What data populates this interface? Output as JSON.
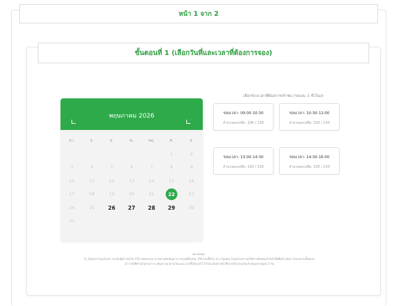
{
  "page_banner": "หน้า 1 จาก 2",
  "step_title": "ขั้นตอนที่ 1 (เลือกวันที่และเวลาที่ต้องการจอง)",
  "calendar": {
    "month_title": "พฤษภาคม 2026",
    "prev_icon": "corner-prev-icon",
    "next_icon": "corner-next-icon",
    "weekdays": [
      "อา.",
      "จ.",
      "อ.",
      "พ.",
      "พฤ.",
      "ศ.",
      "ส."
    ],
    "days": [
      {
        "label": "",
        "state": "empty"
      },
      {
        "label": "",
        "state": "empty"
      },
      {
        "label": "",
        "state": "empty"
      },
      {
        "label": "",
        "state": "empty"
      },
      {
        "label": "",
        "state": "empty"
      },
      {
        "label": "1",
        "state": "disabled"
      },
      {
        "label": "2",
        "state": "disabled"
      },
      {
        "label": "3",
        "state": "disabled"
      },
      {
        "label": "4",
        "state": "disabled"
      },
      {
        "label": "5",
        "state": "disabled"
      },
      {
        "label": "6",
        "state": "disabled"
      },
      {
        "label": "7",
        "state": "disabled"
      },
      {
        "label": "8",
        "state": "disabled"
      },
      {
        "label": "9",
        "state": "disabled"
      },
      {
        "label": "10",
        "state": "disabled"
      },
      {
        "label": "11",
        "state": "disabled"
      },
      {
        "label": "12",
        "state": "disabled"
      },
      {
        "label": "13",
        "state": "disabled"
      },
      {
        "label": "14",
        "state": "disabled"
      },
      {
        "label": "15",
        "state": "disabled"
      },
      {
        "label": "16",
        "state": "disabled"
      },
      {
        "label": "17",
        "state": "disabled"
      },
      {
        "label": "18",
        "state": "disabled"
      },
      {
        "label": "19",
        "state": "disabled"
      },
      {
        "label": "20",
        "state": "disabled"
      },
      {
        "label": "21",
        "state": "disabled"
      },
      {
        "label": "22",
        "state": "selected"
      },
      {
        "label": "23",
        "state": "disabled"
      },
      {
        "label": "24",
        "state": "disabled"
      },
      {
        "label": "25",
        "state": "disabled"
      },
      {
        "label": "26",
        "state": "available"
      },
      {
        "label": "27",
        "state": "available"
      },
      {
        "label": "28",
        "state": "available"
      },
      {
        "label": "29",
        "state": "available"
      },
      {
        "label": "30",
        "state": "disabled"
      },
      {
        "label": "31",
        "state": "disabled"
      }
    ]
  },
  "slots_heading": "เลือกช่วงเวลาที่ต้องการเข้าชม (รอบละ 1 ชั่วโมง)",
  "slots": [
    {
      "time": "รอบเวลา: 09:00-10:30",
      "remaining": "จำนวนคงเหลือ: 106 / 150"
    },
    {
      "time": "รอบเวลา: 10:30-12:00",
      "remaining": "จำนวนคงเหลือ: 150 / 150"
    },
    {
      "time": "รอบเวลา: 13:00-14:30",
      "remaining": "จำนวนคงเหลือ: 150 / 150"
    },
    {
      "time": "รอบเวลา: 14:30-16:00",
      "remaining": "จำนวนคงเหลือ: 150 / 150"
    }
  ],
  "notes": {
    "heading": "หมายเหตุ :",
    "line1": "1) Space Inspirium รองรับผู้เข้าชมได้ 150 คนต่อรอบ หากท่านพบปัญหาการจองที่นั่งเกิน 150 คนขึ้นไป ทาง Space Inspirium ขอให้ท่านติดต่อเจ้าหน้าที่เพื่อดำเนินการจองตามขั้นตอน",
    "line2": "2) กรณีที่ท่านไม่สามารถ เดินทางมาตามวันและเวลาที่ได้จองไว้ โปรดแจ้งเจ้าหน้าที่ล่วงหน้าก่อนวันเข้าชมอย่างน้อย 3 วัน"
  },
  "colors": {
    "accent": "#2eaa4a",
    "title_green": "#2e9d3f"
  }
}
